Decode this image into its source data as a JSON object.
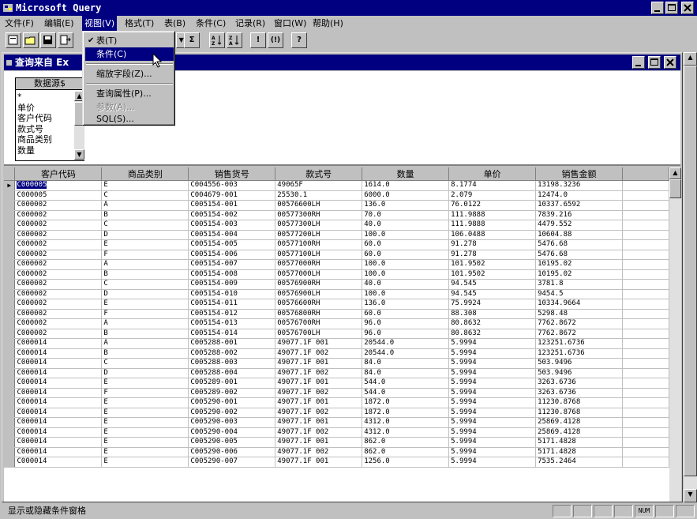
{
  "app": {
    "title": "Microsoft Query"
  },
  "menubar": [
    "文件(F)",
    "编辑(E)",
    "视图(V)",
    "格式(T)",
    "表(B)",
    "条件(C)",
    "记录(R)",
    "窗口(W)",
    "帮助(H)"
  ],
  "view_menu": {
    "items": [
      {
        "label": "表(T)",
        "checked": true
      },
      {
        "label": "条件(C)",
        "highlighted": true
      },
      {
        "label": "缩放字段(Z)..."
      },
      {
        "label": "查询属性(P)..."
      },
      {
        "label": "参数(A)...",
        "disabled": true
      },
      {
        "label": "SQL(S)..."
      }
    ]
  },
  "toolbar": {
    "sum": "Σ"
  },
  "query_window": {
    "title": "查询来自 Ex"
  },
  "datasource": {
    "name": "数据源$",
    "fields": [
      "*",
      "单价",
      "客户代码",
      "款式号",
      "商品类别",
      "数量"
    ]
  },
  "grid": {
    "columns": [
      "客户代码",
      "商品类别",
      "销售货号",
      "款式号",
      "数量",
      "单价",
      "销售金额"
    ],
    "rows": [
      [
        "C000005",
        "E",
        "C004556-003",
        "49065F",
        "1614.0",
        "8.1774",
        "13198.3236"
      ],
      [
        "C000005",
        "C",
        "C004679-001",
        "25530.1",
        "6000.0",
        "2.079",
        "12474.0"
      ],
      [
        "C000002",
        "A",
        "C005154-001",
        "00576600LH",
        "136.0",
        "76.0122",
        "10337.6592"
      ],
      [
        "C000002",
        "B",
        "C005154-002",
        "00577300RH",
        "70.0",
        "111.9888",
        "7839.216"
      ],
      [
        "C000002",
        "C",
        "C005154-003",
        "00577300LH",
        "40.0",
        "111.9888",
        "4479.552"
      ],
      [
        "C000002",
        "D",
        "C005154-004",
        "00577200LH",
        "100.0",
        "106.0488",
        "10604.88"
      ],
      [
        "C000002",
        "E",
        "C005154-005",
        "00577100RH",
        "60.0",
        "91.278",
        "5476.68"
      ],
      [
        "C000002",
        "F",
        "C005154-006",
        "00577100LH",
        "60.0",
        "91.278",
        "5476.68"
      ],
      [
        "C000002",
        "A",
        "C005154-007",
        "00577000RH",
        "100.0",
        "101.9502",
        "10195.02"
      ],
      [
        "C000002",
        "B",
        "C005154-008",
        "00577000LH",
        "100.0",
        "101.9502",
        "10195.02"
      ],
      [
        "C000002",
        "C",
        "C005154-009",
        "00576900RH",
        "40.0",
        "94.545",
        "3781.8"
      ],
      [
        "C000002",
        "D",
        "C005154-010",
        "00576900LH",
        "100.0",
        "94.545",
        "9454.5"
      ],
      [
        "C000002",
        "E",
        "C005154-011",
        "00576600RH",
        "136.0",
        "75.9924",
        "10334.9664"
      ],
      [
        "C000002",
        "F",
        "C005154-012",
        "00576800RH",
        "60.0",
        "88.308",
        "5298.48"
      ],
      [
        "C000002",
        "A",
        "C005154-013",
        "00576700RH",
        "96.0",
        "80.8632",
        "7762.8672"
      ],
      [
        "C000002",
        "B",
        "C005154-014",
        "00576700LH",
        "96.0",
        "80.8632",
        "7762.8672"
      ],
      [
        "C000014",
        "A",
        "C005288-001",
        "49077.1F 001",
        "20544.0",
        "5.9994",
        "123251.6736"
      ],
      [
        "C000014",
        "B",
        "C005288-002",
        "49077.1F 002",
        "20544.0",
        "5.9994",
        "123251.6736"
      ],
      [
        "C000014",
        "C",
        "C005288-003",
        "49077.1F 001",
        "84.0",
        "5.9994",
        "503.9496"
      ],
      [
        "C000014",
        "D",
        "C005288-004",
        "49077.1F 002",
        "84.0",
        "5.9994",
        "503.9496"
      ],
      [
        "C000014",
        "E",
        "C005289-001",
        "49077.1F 001",
        "544.0",
        "5.9994",
        "3263.6736"
      ],
      [
        "C000014",
        "F",
        "C005289-002",
        "49077.1F 002",
        "544.0",
        "5.9994",
        "3263.6736"
      ],
      [
        "C000014",
        "E",
        "C005290-001",
        "49077.1F 001",
        "1872.0",
        "5.9994",
        "11230.8768"
      ],
      [
        "C000014",
        "E",
        "C005290-002",
        "49077.1F 002",
        "1872.0",
        "5.9994",
        "11230.8768"
      ],
      [
        "C000014",
        "E",
        "C005290-003",
        "49077.1F 001",
        "4312.0",
        "5.9994",
        "25869.4128"
      ],
      [
        "C000014",
        "E",
        "C005290-004",
        "49077.1F 002",
        "4312.0",
        "5.9994",
        "25869.4128"
      ],
      [
        "C000014",
        "E",
        "C005290-005",
        "49077.1F 001",
        "862.0",
        "5.9994",
        "5171.4828"
      ],
      [
        "C000014",
        "E",
        "C005290-006",
        "49077.1F 002",
        "862.0",
        "5.9994",
        "5171.4828"
      ],
      [
        "C000014",
        "E",
        "C005290-007",
        "49077.1F 001",
        "1256.0",
        "5.9994",
        "7535.2464"
      ]
    ]
  },
  "statusbar": {
    "message": "显示或隐藏条件窗格",
    "num": "NUM"
  }
}
